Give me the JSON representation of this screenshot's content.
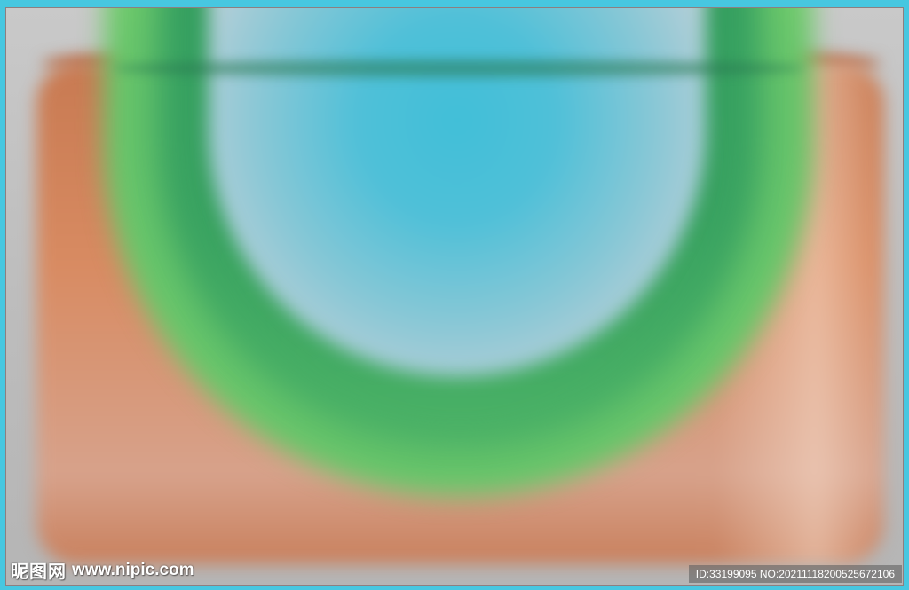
{
  "image": {
    "colors": {
      "border": "#47c7e0",
      "frame": "#c4c4c4",
      "slab": "#d88b62",
      "arch_green": "#3aa06a",
      "arch_light_green": "#9ee08e",
      "dome_blue": "#41bfd8"
    }
  },
  "watermark": {
    "logo_text": "昵图网",
    "site": "www.nipic.com",
    "id_text": "ID:33199095 NO:20211118200525672106"
  }
}
